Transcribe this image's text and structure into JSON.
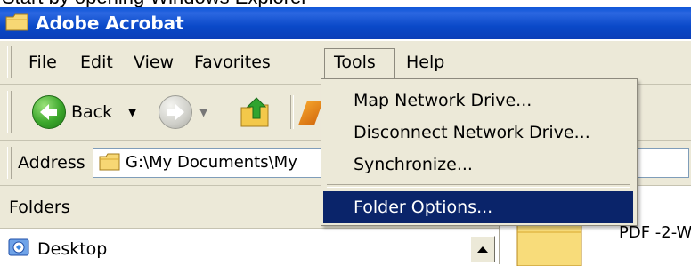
{
  "caption": {
    "text": "Start by opening Windows Explorer"
  },
  "window": {
    "title": "Adobe Acrobat"
  },
  "menu": {
    "items": [
      "File",
      "Edit",
      "View",
      "Favorites",
      "Tools",
      "Help"
    ],
    "open_index": 4
  },
  "toolbar": {
    "back_label": "Back"
  },
  "address": {
    "label": "Address",
    "value": "G:\\My Documents\\My"
  },
  "tools_menu": {
    "items": [
      "Map Network Drive...",
      "Disconnect Network Drive...",
      "Synchronize..."
    ],
    "highlighted_item": "Folder Options..."
  },
  "folders_pane": {
    "title": "Folders",
    "items": [
      "Desktop"
    ]
  },
  "file_list": {
    "items": [
      "PDF -2-W"
    ]
  },
  "colors": {
    "title_bar": "#0a49c8",
    "menu_bg": "#ece9d8",
    "highlight": "#0a246a"
  },
  "icons": [
    "folder-icon",
    "back-icon",
    "forward-icon",
    "folder-up-icon",
    "desktop-icon",
    "scroll-up-arrow-icon"
  ]
}
